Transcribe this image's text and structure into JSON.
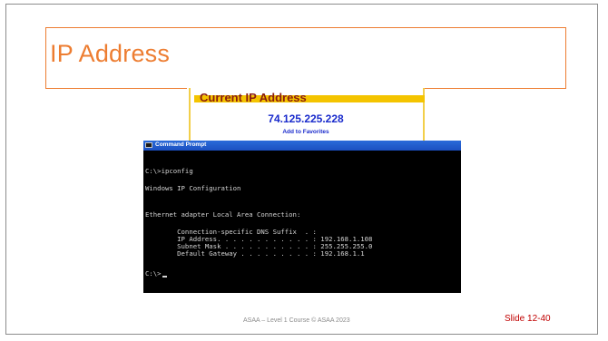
{
  "slide": {
    "title": "IP Address",
    "footer": "ASAA – Level 1 Course © ASAA 2023",
    "slide_number": "Slide 12-40"
  },
  "ip_panel": {
    "heading": "Current IP Address",
    "ip_value": "74.125.225.228",
    "favorites_link": "Add to Favorites"
  },
  "cmd": {
    "window_title": "Command Prompt",
    "lines": [
      "C:\\>ipconfig",
      "Windows IP Configuration",
      "Ethernet adapter Local Area Connection:",
      "        Connection-specific DNS Suffix  . :",
      "        IP Address. . . . . . . . . . . . : 192.168.1.108",
      "        Subnet Mask . . . . . . . . . . . : 255.255.255.0",
      "        Default Gateway . . . . . . . . . : 192.168.1.1",
      "C:\\>"
    ]
  }
}
